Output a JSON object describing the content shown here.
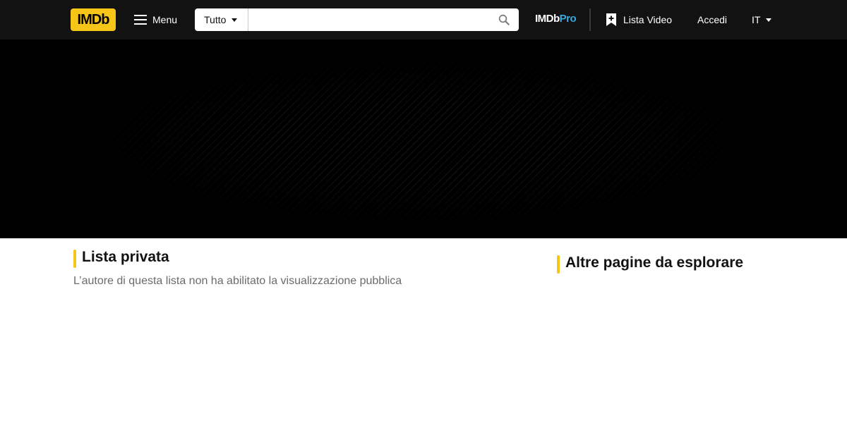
{
  "colors": {
    "brand": "#f5c518",
    "topbar": "#121212",
    "pro_accent": "#3aa9de"
  },
  "header": {
    "logo_text": "IMDb",
    "menu_label": "Menu",
    "search": {
      "category": "Tutto",
      "value": "",
      "placeholder": ""
    },
    "pro_prefix": "IMDb",
    "pro_suffix": "Pro",
    "watchlist_label": "Lista Video",
    "signin_label": "Accedi",
    "language": "IT"
  },
  "main": {
    "title": "Lista privata",
    "description": "L’autore di questa lista non ha abilitato la visualizzazione pubblica"
  },
  "sidebar": {
    "title": "Altre pagine da esplorare"
  }
}
